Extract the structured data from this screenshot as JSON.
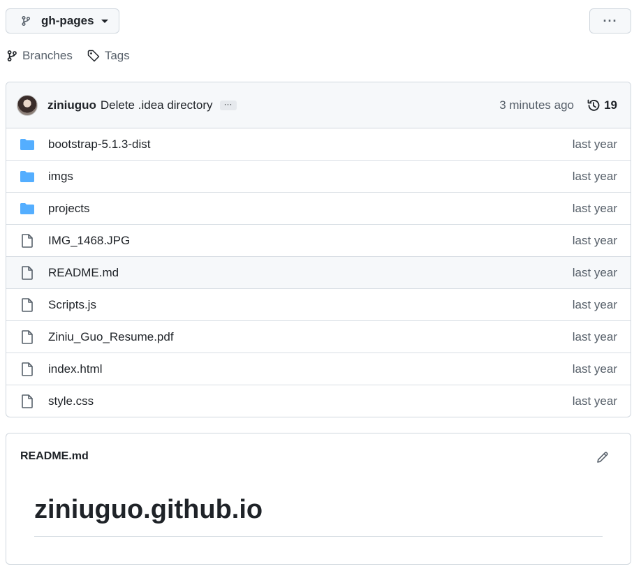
{
  "branch": {
    "name": "gh-pages",
    "icon": "git-branch-icon"
  },
  "more_button": {
    "label": "···"
  },
  "links": {
    "branches": "Branches",
    "tags": "Tags"
  },
  "latest_commit": {
    "author": "ziniuguo",
    "message": "Delete .idea directory",
    "ellipsis": "···",
    "time": "3 minutes ago",
    "commit_count": "19"
  },
  "files": [
    {
      "name": "bootstrap-5.1.3-dist",
      "type": "folder",
      "date": "last year"
    },
    {
      "name": "imgs",
      "type": "folder",
      "date": "last year"
    },
    {
      "name": "projects",
      "type": "folder",
      "date": "last year"
    },
    {
      "name": "IMG_1468.JPG",
      "type": "file",
      "date": "last year"
    },
    {
      "name": "README.md",
      "type": "file",
      "date": "last year"
    },
    {
      "name": "Scripts.js",
      "type": "file",
      "date": "last year"
    },
    {
      "name": "Ziniu_Guo_Resume.pdf",
      "type": "file",
      "date": "last year"
    },
    {
      "name": "index.html",
      "type": "file",
      "date": "last year"
    },
    {
      "name": "style.css",
      "type": "file",
      "date": "last year"
    }
  ],
  "readme": {
    "title": "README.md",
    "heading": "ziniuguo.github.io"
  },
  "colors": {
    "folder": "#54aeff",
    "muted": "#57606a",
    "text": "#1f2328",
    "border": "#d0d7de"
  }
}
